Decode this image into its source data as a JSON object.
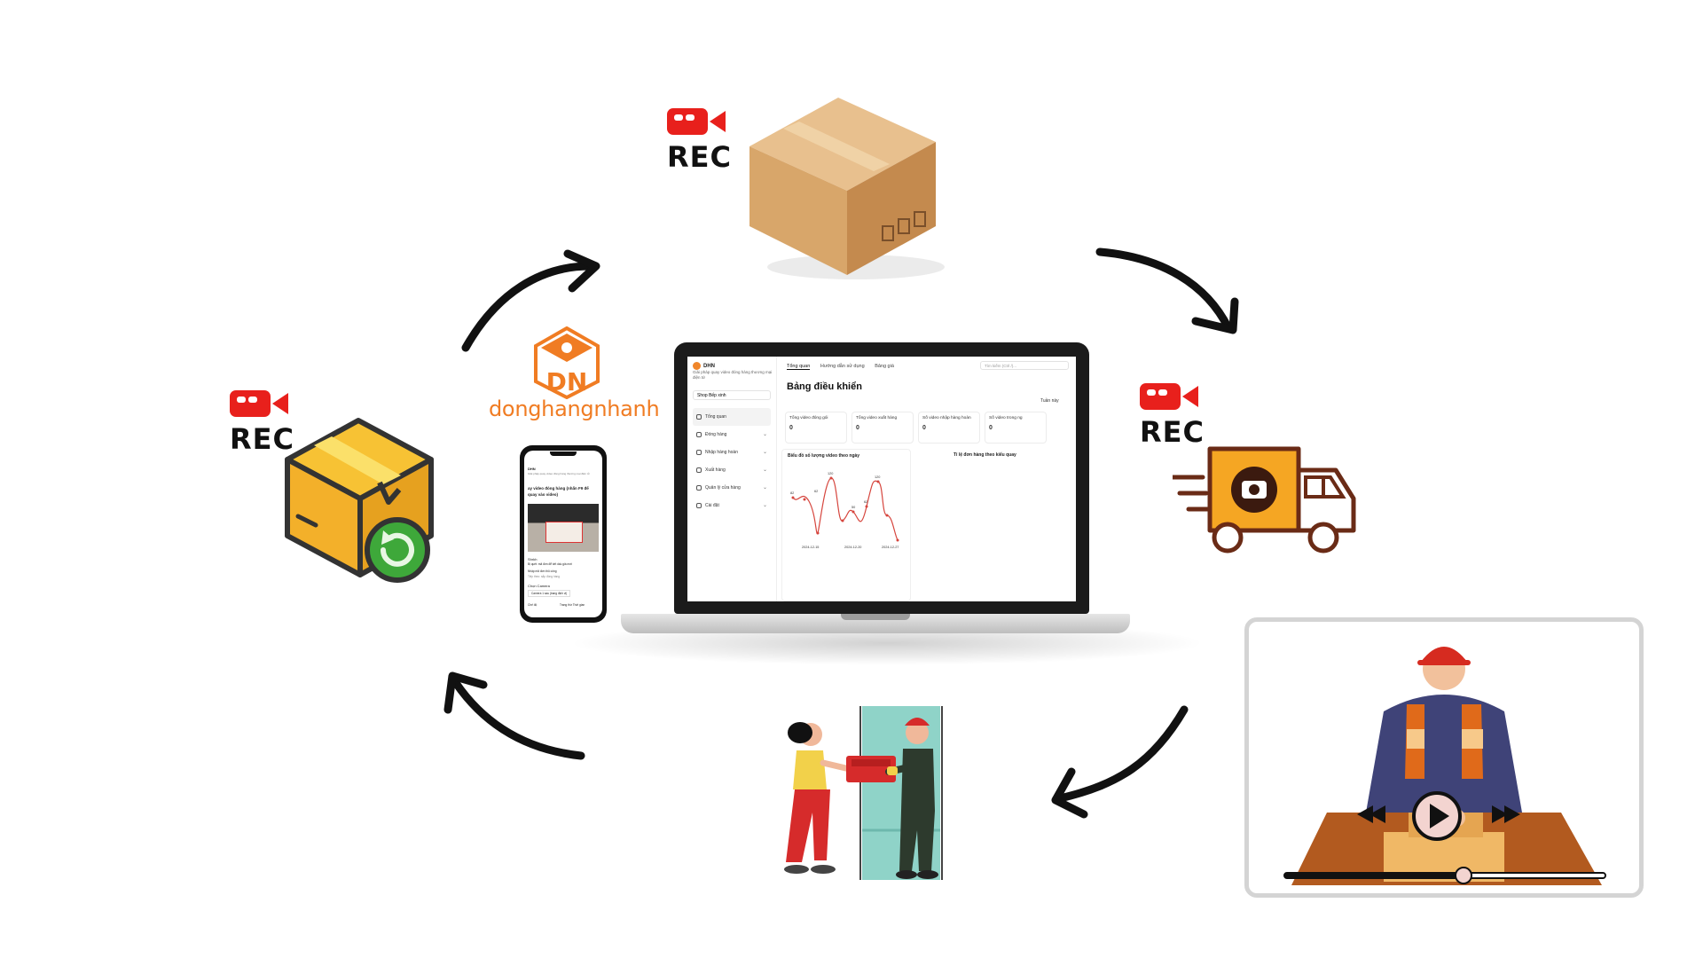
{
  "brand": {
    "logo_monogram": "DN",
    "logo_text": "donghangnhanh",
    "color": "#f07c23"
  },
  "rec_badges": [
    {
      "label": "REC",
      "icon": "video-camera-icon",
      "color": "#e8201c"
    },
    {
      "label": "REC",
      "icon": "video-camera-icon",
      "color": "#e8201c"
    },
    {
      "label": "REC",
      "icon": "video-camera-icon",
      "color": "#e8201c"
    }
  ],
  "dashboard": {
    "brand_name": "DHN",
    "brand_tagline": "Giải pháp quay video đóng hàng thương mại điện tử",
    "shop_selector": "Shop Bếp xinh",
    "menu": [
      {
        "label": "Tổng quan",
        "active": true
      },
      {
        "label": "Đóng hàng"
      },
      {
        "label": "Nhập hàng hoàn"
      },
      {
        "label": "Xuất hàng"
      },
      {
        "label": "Quản lý cửa hàng"
      },
      {
        "label": "Cài đặt"
      }
    ],
    "top_nav": [
      "Tổng quan",
      "Hướng dẫn sử dụng",
      "Bảng giá"
    ],
    "search_placeholder": "Tìm kiếm (Ctrl /)...",
    "title": "Bảng điều khiển",
    "range": "Tuần này",
    "cards": [
      {
        "label": "Tổng video đóng gói",
        "value": "0"
      },
      {
        "label": "Tổng video xuất hàng",
        "value": "0"
      },
      {
        "label": "Số video nhập hàng hoàn",
        "value": "0"
      },
      {
        "label": "Số video trong ng",
        "value": "0"
      }
    ],
    "line_chart_title": "Biểu đồ số lượng video theo ngày",
    "pie_chart_title": "Tỉ lệ đơn hàng theo kiểu quay",
    "chart_x_ticks": [
      "2024-12-15",
      "2024-12-20",
      "2024-12-27"
    ],
    "chart_point_labels": [
      "82",
      "62",
      "120",
      "50",
      "62",
      "120"
    ]
  },
  "phone": {
    "app_title": "DHN",
    "line1": "Giải pháp quay video đóng hàng thương mại điện tử",
    "heading": "ay video đóng hàng (nhấn F9 để",
    "heading2": "quay vào video)",
    "item1": "Shrkh",
    "item2": "Bị quét: mã đơn để kết dấu giá mới",
    "item3": "Nhập mã đơn thủ công",
    "item4": "Tiếp theo: sắp đóng hàng",
    "camera_label": "Chọn Camera",
    "camera_value": "Camera 1 sau (bang định vị)",
    "footer_left": "Chế độ",
    "footer_right": "Trang thứ Thời gian"
  }
}
